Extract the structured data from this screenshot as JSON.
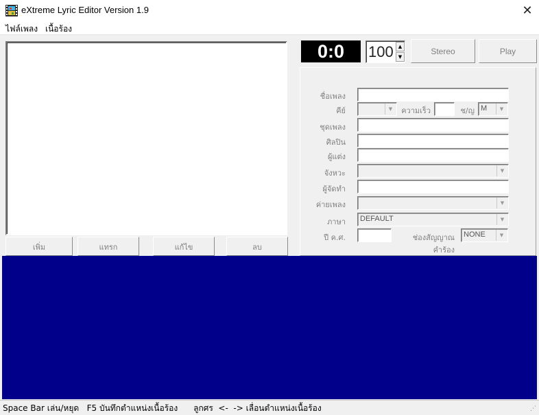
{
  "window": {
    "title": "eXtreme Lyric Editor Version 1.9",
    "close_glyph": "✕"
  },
  "menu": [
    {
      "label": "ไฟล์เพลง"
    },
    {
      "label": "เนื้อร้อง"
    }
  ],
  "list_buttons": {
    "add": "เพิ่ม",
    "insert": "แทรก",
    "edit": "แก้ไข",
    "delete": "ลบ"
  },
  "player": {
    "time": "0:0",
    "tempo": "100",
    "stereo_label": "Stereo",
    "play_label": "Play"
  },
  "info": {
    "song_name_label": "ชื่อเพลง",
    "key_label": "คีย์",
    "speed_label": "ความเร็ว",
    "gender_label": "ช/ญ",
    "gender_value": "M",
    "album_label": "ชุดเพลง",
    "artist_label": "ศิลปิน",
    "composer_label": "ผู้แต่ง",
    "rhythm_label": "จังหวะ",
    "producer_label": "ผู้จัดทำ",
    "label_label": "ค่ายเพลง",
    "language_label": "ภาษา",
    "language_value": "DEFAULT",
    "year_label": "ปี ค.ศ.",
    "signal_label": "ช่องสัญญาณคำร้อง",
    "signal_value": "NONE"
  },
  "status": {
    "text": "Space Bar เล่น/หยุด   F5 บันทึกตำแหน่งเนื้อร้อง      ลูกศร  <-  -> เลื่อนตำแหน่งเนื้อร้อง"
  },
  "colors": {
    "lyric_background": "#00008b",
    "time_background": "#000000"
  },
  "icons": {
    "app": "film-reel-icon",
    "close": "close-icon",
    "spin_up": "up-arrow-icon",
    "spin_down": "down-arrow-icon",
    "dropdown": "chevron-down-icon"
  }
}
